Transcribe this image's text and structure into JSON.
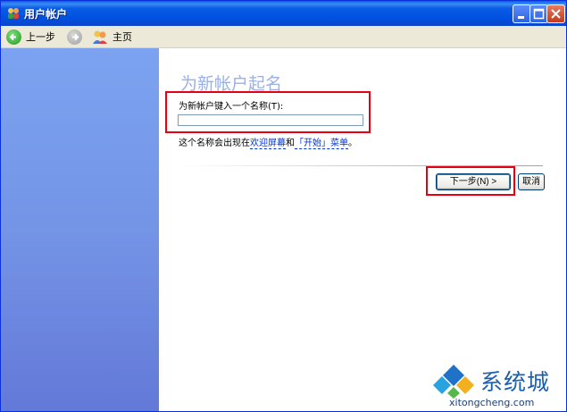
{
  "window": {
    "title": "用户帐户"
  },
  "toolbar": {
    "back_label": "上一步",
    "home_label": "主页"
  },
  "content": {
    "heading": "为新帐户起名",
    "field_label": "为新帐户键入一个名称(T):",
    "name_value": "",
    "note_prefix": "这个名称会出现在",
    "note_link_welcome": "欢迎屏幕",
    "note_and": "和",
    "note_link_start": "「开始」菜单",
    "note_suffix": "。"
  },
  "buttons": {
    "next_label": "下一步(N) >",
    "cancel_label": "取消"
  },
  "watermark": {
    "brand": "系统城",
    "url": "xitongcheng.com"
  },
  "colors": {
    "highlight": "#e60012",
    "title_bar": "#0a5be4",
    "heading": "#9ab1e6",
    "sidebar": "#7494e6"
  }
}
